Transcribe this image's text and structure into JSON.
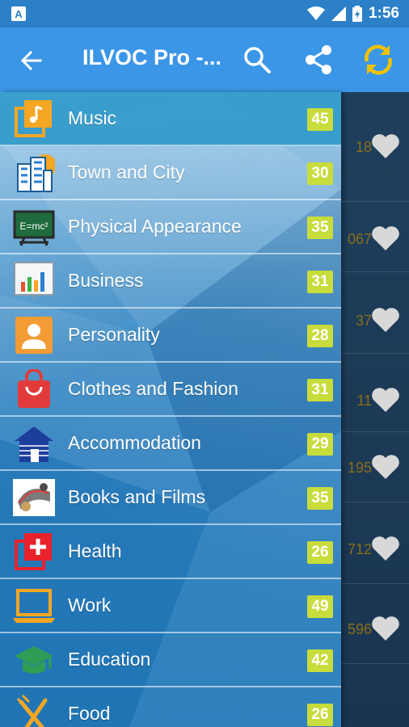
{
  "status_bar": {
    "time": "1:56",
    "icons": [
      "notification-icon",
      "wifi-icon",
      "signal-icon",
      "battery-icon"
    ]
  },
  "app_bar": {
    "title": "ILVOC Pro -...",
    "icons": [
      "back-arrow-icon",
      "search-icon",
      "share-icon",
      "sync-icon"
    ]
  },
  "colors": {
    "app_bar": "#3b96e8",
    "status_bar": "#2c80c8",
    "badge": "#c8dc3c",
    "sync_icon": "#f2c200"
  },
  "categories": [
    {
      "label": "Music",
      "count": "45",
      "icon": "music-note-icon"
    },
    {
      "label": "Town and City",
      "count": "30",
      "icon": "city-buildings-icon"
    },
    {
      "label": "Physical Appearance",
      "count": "35",
      "icon": "formula-board-icon"
    },
    {
      "label": "Business",
      "count": "31",
      "icon": "bar-chart-board-icon"
    },
    {
      "label": "Personality",
      "count": "28",
      "icon": "person-icon"
    },
    {
      "label": "Clothes and Fashion",
      "count": "31",
      "icon": "shopping-bag-icon"
    },
    {
      "label": "Accommodation",
      "count": "29",
      "icon": "log-cabin-icon"
    },
    {
      "label": "Books and Films",
      "count": "35",
      "icon": "film-reel-icon"
    },
    {
      "label": "Health",
      "count": "26",
      "icon": "medical-cross-icon"
    },
    {
      "label": "Work",
      "count": "49",
      "icon": "laptop-icon"
    },
    {
      "label": "Education",
      "count": "42",
      "icon": "graduation-cap-icon"
    },
    {
      "label": "Food",
      "count": "26",
      "icon": "cutlery-icon"
    }
  ],
  "background_items": [
    {
      "number": "18"
    },
    {
      "number": "067"
    },
    {
      "number": "37"
    },
    {
      "number": "11"
    },
    {
      "number": "195"
    },
    {
      "number": "712"
    },
    {
      "number": "596"
    }
  ]
}
